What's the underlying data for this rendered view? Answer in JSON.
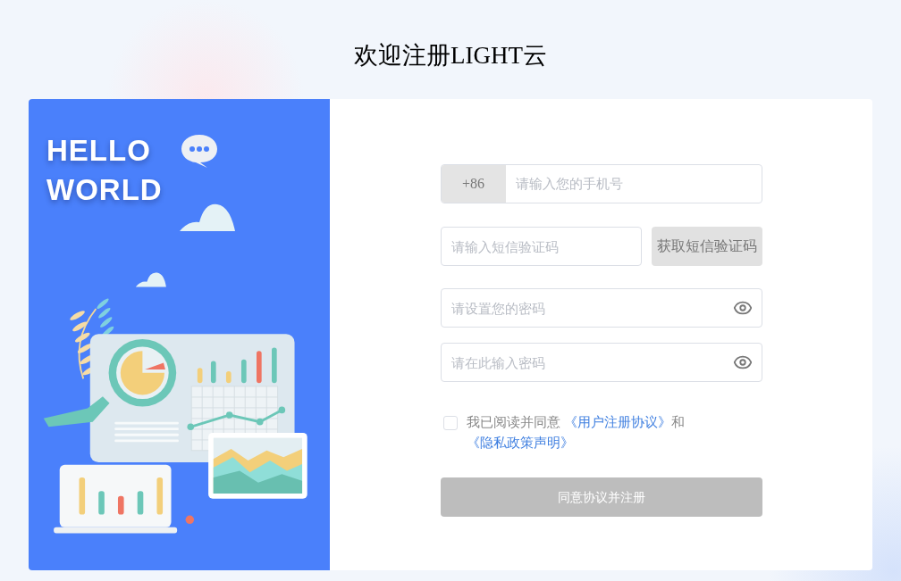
{
  "page_title": "欢迎注册LIGHT云",
  "banner": {
    "lines": [
      "HELLO",
      "WORLD"
    ]
  },
  "form": {
    "phone": {
      "prefix": "+86",
      "placeholder": "请输入您的手机号"
    },
    "sms": {
      "placeholder": "请输入短信验证码",
      "button": "获取短信验证码",
      "disabled": true
    },
    "password": {
      "placeholder": "请设置您的密码"
    },
    "confirm": {
      "placeholder": "请在此输入密码"
    },
    "agreement": {
      "checked": false,
      "parts": [
        {
          "kind": "text",
          "text": "我已阅读并同意 "
        },
        {
          "kind": "link",
          "text": "《用户注册协议》"
        },
        {
          "kind": "text",
          "text": "和 "
        },
        {
          "kind": "link",
          "text": "《隐私政策声明》"
        }
      ]
    },
    "submit": {
      "label": "同意协议并注册",
      "disabled": true
    }
  }
}
